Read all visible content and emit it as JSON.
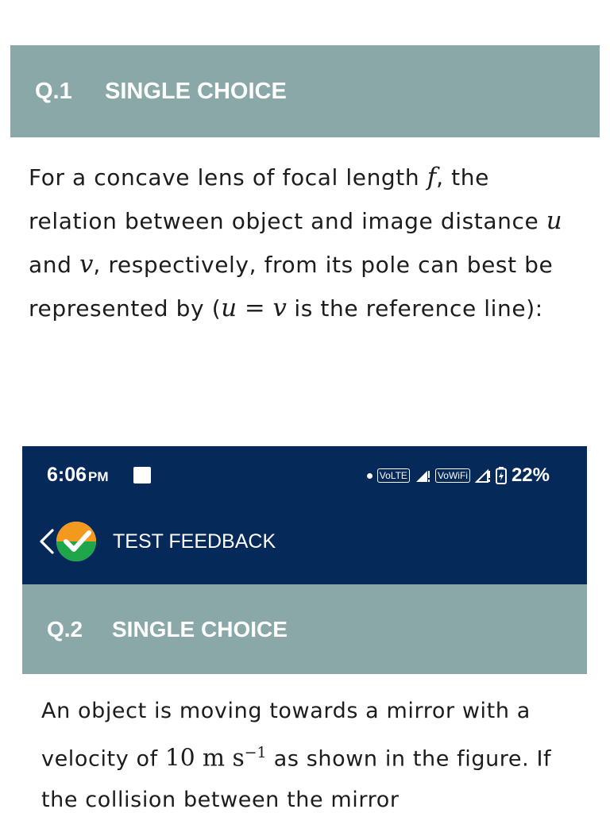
{
  "question1": {
    "number": "Q.1",
    "type": "SINGLE CHOICE",
    "text": {
      "s1": "For a concave lens of focal length ",
      "var_f": "f",
      "s2": ", the relation between object and image distance ",
      "var_u": "u",
      "s3": " and ",
      "var_v": "v",
      "s4": ", respectively, from its pole can best be represented by (",
      "eq": "u = v",
      "s5": " is the reference line):"
    }
  },
  "status_bar": {
    "time": "6:06",
    "ampm": "PM",
    "volte": "VoLTE",
    "vowifi": "VoWiFi",
    "battery": "22%"
  },
  "app_bar": {
    "title": "TEST FEEDBACK",
    "background": "#052a5a"
  },
  "question2": {
    "number": "Q.2",
    "type": "SINGLE CHOICE",
    "text": {
      "s1": "An object is moving towards a mirror with a velocity of ",
      "value": "10",
      "unit": "m s",
      "exp": "−1",
      "s2": " as shown in the figure. If the collision between the mirror"
    }
  },
  "colors": {
    "header_bg": "#8aa8a8",
    "logo_orange": "#f39a1e",
    "logo_green": "#1fa64a"
  }
}
